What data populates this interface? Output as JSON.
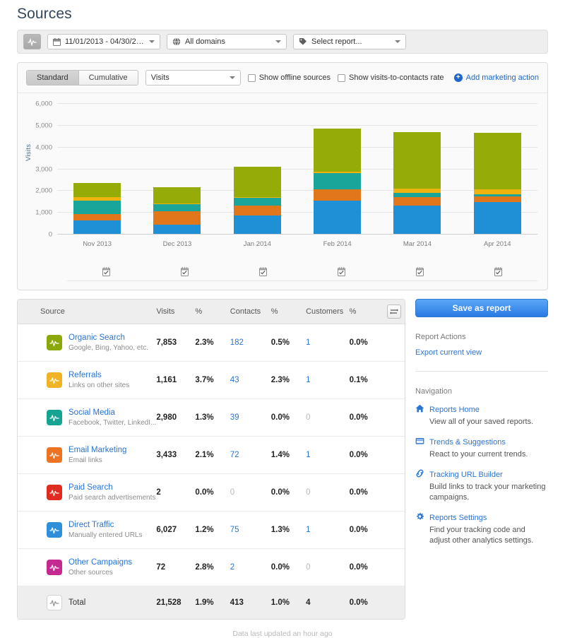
{
  "page_title": "Sources",
  "toolbar": {
    "pulse_icon": "pulse-icon",
    "date_range": "11/01/2013 - 04/30/2014...",
    "domains": "All domains",
    "report": "Select report..."
  },
  "chart_controls": {
    "tabs": [
      {
        "label": "Standard",
        "active": true
      },
      {
        "label": "Cumulative",
        "active": false
      }
    ],
    "metric": "Visits",
    "checkbox_offline": "Show offline sources",
    "checkbox_contacts_rate": "Show visits-to-contacts rate",
    "add_action": "Add marketing action"
  },
  "chart_data": {
    "type": "bar",
    "stacked": true,
    "title": "",
    "xlabel": "",
    "ylabel": "Visits",
    "ylim": [
      0,
      6000
    ],
    "yticks": [
      0,
      1000,
      2000,
      3000,
      4000,
      5000,
      6000
    ],
    "ytick_labels": [
      "0",
      "1,000",
      "2,000",
      "3,000",
      "4,000",
      "5,000",
      "6,000"
    ],
    "grid": true,
    "legend": "none",
    "categories": [
      "Nov 2013",
      "Dec 2013",
      "Jan 2014",
      "Feb 2014",
      "Mar 2014",
      "Apr 2014"
    ],
    "series": [
      {
        "name": "Direct Traffic",
        "color": "#1f8fd6",
        "values": [
          610,
          430,
          830,
          1530,
          1290,
          1470
        ]
      },
      {
        "name": "Email Marketing",
        "color": "#e2761b",
        "values": [
          300,
          600,
          480,
          530,
          390,
          250
        ]
      },
      {
        "name": "Social Media",
        "color": "#1aa59a",
        "values": [
          600,
          330,
          330,
          720,
          200,
          110
        ]
      },
      {
        "name": "Referrals",
        "color": "#efb310",
        "values": [
          180,
          40,
          50,
          90,
          190,
          230
        ]
      },
      {
        "name": "Organic Search",
        "color": "#94ab08",
        "values": [
          630,
          740,
          1380,
          1970,
          2610,
          2590
        ]
      }
    ],
    "totals": [
      2320,
      2140,
      3070,
      4840,
      4680,
      4650
    ],
    "annotations": [
      "annotation-icon",
      "annotation-icon",
      "annotation-icon",
      "annotation-icon",
      "annotation-icon",
      "annotation-icon"
    ]
  },
  "table": {
    "columns": [
      "Source",
      "Visits",
      "%",
      "Contacts",
      "%",
      "Customers",
      "%"
    ],
    "settings_icon": "column-settings-icon",
    "rows": [
      {
        "name": "Organic Search",
        "desc": "Google, Bing, Yahoo, etc.",
        "color": "#8aa80a",
        "visits": "7,853",
        "visits_pct": "2.3%",
        "contacts": "182",
        "contacts_zero": false,
        "contacts_pct": "0.5%",
        "customers": "1",
        "customers_zero": false,
        "customers_pct": "0.0%"
      },
      {
        "name": "Referrals",
        "desc": "Links on other sites",
        "color": "#f0b323",
        "visits": "1,161",
        "visits_pct": "3.7%",
        "contacts": "43",
        "contacts_zero": false,
        "contacts_pct": "2.3%",
        "customers": "1",
        "customers_zero": false,
        "customers_pct": "0.1%"
      },
      {
        "name": "Social Media",
        "desc": "Facebook, Twitter, LinkedI...",
        "color": "#16a391",
        "visits": "2,980",
        "visits_pct": "1.3%",
        "contacts": "39",
        "contacts_zero": false,
        "contacts_pct": "0.0%",
        "customers": "0",
        "customers_zero": true,
        "customers_pct": "0.0%"
      },
      {
        "name": "Email Marketing",
        "desc": "Email links",
        "color": "#ec7324",
        "visits": "3,433",
        "visits_pct": "2.1%",
        "contacts": "72",
        "contacts_zero": false,
        "contacts_pct": "1.4%",
        "customers": "1",
        "customers_zero": false,
        "customers_pct": "0.0%"
      },
      {
        "name": "Paid Search",
        "desc": "Paid search advertisements",
        "color": "#e02b20",
        "visits": "2",
        "visits_pct": "0.0%",
        "contacts": "0",
        "contacts_zero": true,
        "contacts_pct": "0.0%",
        "customers": "0",
        "customers_zero": true,
        "customers_pct": "0.0%"
      },
      {
        "name": "Direct Traffic",
        "desc": "Manually entered URLs",
        "color": "#2e8fdb",
        "visits": "6,027",
        "visits_pct": "1.2%",
        "contacts": "75",
        "contacts_zero": false,
        "contacts_pct": "1.3%",
        "customers": "1",
        "customers_zero": false,
        "customers_pct": "0.0%"
      },
      {
        "name": "Other Campaigns",
        "desc": "Other sources",
        "color": "#c42a90",
        "visits": "72",
        "visits_pct": "2.8%",
        "contacts": "2",
        "contacts_zero": false,
        "contacts_pct": "0.0%",
        "customers": "0",
        "customers_zero": true,
        "customers_pct": "0.0%"
      }
    ],
    "total": {
      "name": "Total",
      "visits": "21,528",
      "visits_pct": "1.9%",
      "contacts": "413",
      "contacts_pct": "1.0%",
      "customers": "4",
      "customers_pct": "0.0%"
    }
  },
  "sidebar": {
    "save_button": "Save as report",
    "report_actions_heading": "Report Actions",
    "export_link": "Export current view",
    "navigation_heading": "Navigation",
    "nav_items": [
      {
        "icon": "home-icon",
        "title": "Reports Home",
        "desc": "View all of your saved reports."
      },
      {
        "icon": "book-icon",
        "title": "Trends & Suggestions",
        "desc": "React to your current trends."
      },
      {
        "icon": "link-icon",
        "title": "Tracking URL Builder",
        "desc": "Build links to track your marketing campaigns."
      },
      {
        "icon": "gear-icon",
        "title": "Reports Settings",
        "desc": "Find your tracking code and adjust other analytics settings."
      }
    ]
  },
  "footer": "Data last updated an hour ago"
}
